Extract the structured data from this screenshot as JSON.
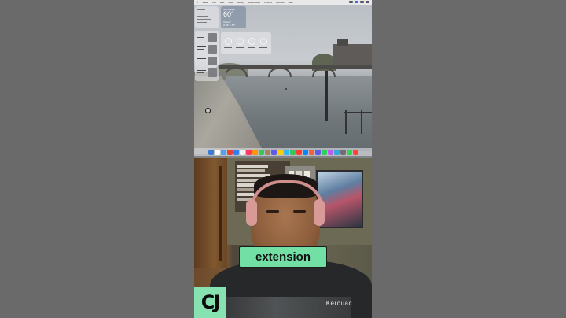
{
  "menubar": {
    "items": [
      "Safari",
      "File",
      "Edit",
      "View",
      "History",
      "Bookmarks",
      "Profiles",
      "Window",
      "Help"
    ]
  },
  "widgets": {
    "weather": {
      "location": "San Rafael",
      "temperature": "60°",
      "condition": "Cloudy",
      "high_low": "H:66° L:50°"
    }
  },
  "dock": {
    "icon_colors": [
      "#3a7bd5",
      "#ffffff",
      "#4da3f5",
      "#e94235",
      "#2d7ff9",
      "#f2f2f2",
      "#ff375f",
      "#ff9500",
      "#34c759",
      "#a2845e",
      "#5e5ce6",
      "#ffcc00",
      "#2fb8f8",
      "#34c759",
      "#ff3b30",
      "#0a84ff",
      "#f56040",
      "#5e5ce6",
      "#30d158",
      "#bf5af2",
      "#34aadc",
      "#6e6e73",
      "#32d74b",
      "#ff453a"
    ]
  },
  "caption": {
    "text": "extension"
  },
  "logo": {
    "text": "CJ"
  },
  "shirt": {
    "text": "Kerouac"
  },
  "colors": {
    "caption_bg": "#72e0a4",
    "logo_bg": "#86e2b1",
    "page_bg": "#6a6a6a"
  }
}
